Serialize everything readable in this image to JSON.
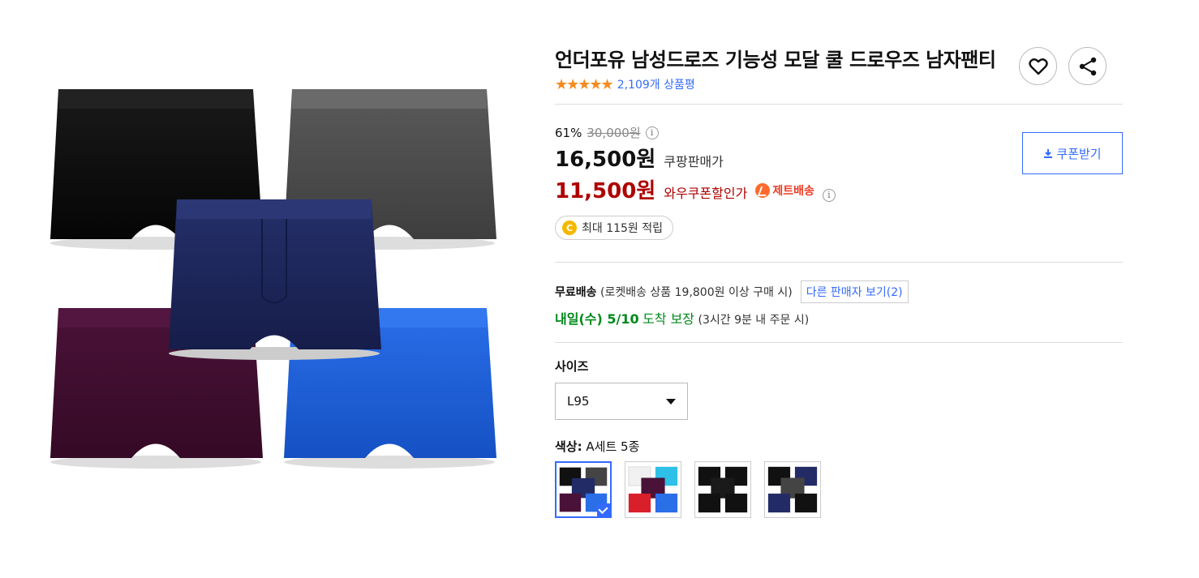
{
  "product": {
    "title": "언더포유 남성드로즈 기능성 모달 쿨 드로우즈 남자팬티",
    "stars": "★★★★★",
    "review_count": "2,109개 상품평",
    "rating": 5
  },
  "price": {
    "discount_rate": "61%",
    "original_price": "30,000원",
    "info_glyph": "i",
    "sale_price": "16,500원",
    "sale_label": "쿠팡판매가",
    "wow_price": "11,500원",
    "wow_label": "와우쿠폰할인가",
    "jet_label": "제트배송",
    "coupon_button": "쿠폰받기",
    "points_coin": "C",
    "points": "최대 115원 적립"
  },
  "shipping": {
    "free_label": "무료배송",
    "free_condition": "(로켓배송 상품 19,800원 이상 구매 시)",
    "other_sellers": "다른 판매자 보기(2)",
    "arrival_date": "내일(수) 5/10",
    "arrival_guarantee": "도착 보장",
    "arrival_note": "(3시간 9분 내 주문 시)"
  },
  "options": {
    "size_title": "사이즈",
    "size_value": "L95",
    "color_title": "색상:",
    "color_value": "A세트 5종"
  },
  "colors": {
    "accent": "#346aff",
    "wow_red": "#ae0000",
    "arrival_green": "#00891a",
    "star_orange": "#f58a1e"
  },
  "icons": {
    "wishlist": "heart-icon",
    "share": "share-icon",
    "coupon": "download-icon",
    "size_dropdown": "caret-down-icon"
  }
}
